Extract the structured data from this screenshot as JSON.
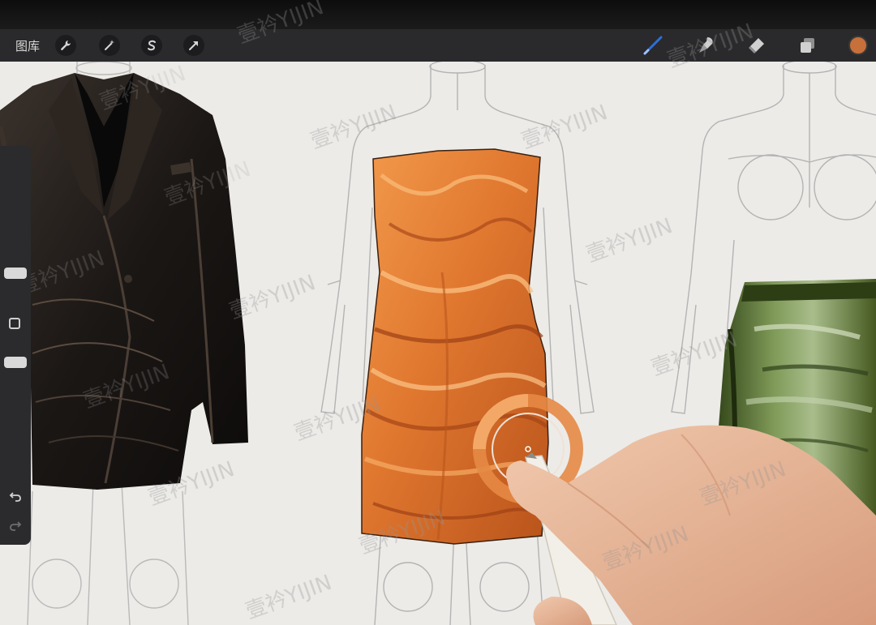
{
  "toolbar": {
    "gallery_label": "图库",
    "tools": [
      "wrench-icon",
      "magic-wand-icon",
      "selection-s-icon",
      "transform-arrow-icon"
    ],
    "right_tools": [
      "brush-icon",
      "smudge-icon",
      "eraser-icon",
      "layers-icon"
    ],
    "active_color": "#c8703a"
  },
  "watermark": {
    "text": "壹衿YIJIN"
  },
  "sidebar": {
    "icons": [
      "undo-icon",
      "redo-icon"
    ]
  },
  "colors": {
    "toolbar_bg": "#2a2a2c",
    "canvas_bg": "#ecebe8",
    "brush_accent": "#2f6fd6",
    "dress_orange": "#e0772f",
    "blazer_black": "#1b1715",
    "skirt_green": "#5d7436"
  }
}
